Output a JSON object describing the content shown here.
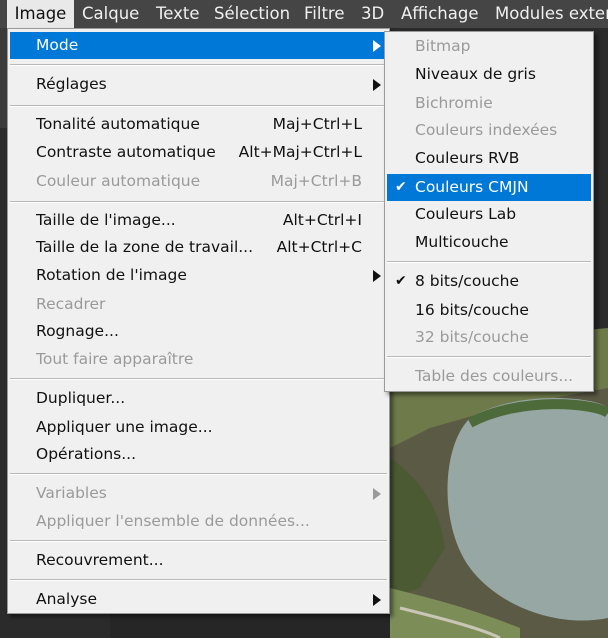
{
  "menubar": {
    "items": [
      "Image",
      "Calque",
      "Texte",
      "Sélection",
      "Filtre",
      "3D",
      "Affichage",
      "Modules exter"
    ]
  },
  "image_menu": {
    "mode": "Mode",
    "reglages": "Réglages",
    "tonalite": {
      "label": "Tonalité automatique",
      "shortcut": "Maj+Ctrl+L"
    },
    "contraste": {
      "label": "Contraste automatique",
      "shortcut": "Alt+Maj+Ctrl+L"
    },
    "couleur_auto": {
      "label": "Couleur automatique",
      "shortcut": "Maj+Ctrl+B"
    },
    "taille_image": {
      "label": "Taille de l'image...",
      "shortcut": "Alt+Ctrl+I"
    },
    "taille_zone": {
      "label": "Taille de la zone de travail...",
      "shortcut": "Alt+Ctrl+C"
    },
    "rotation": "Rotation de l'image",
    "recadrer": "Recadrer",
    "rognage": "Rognage...",
    "tout_faire": "Tout faire apparaître",
    "dupliquer": "Dupliquer...",
    "appliquer_image": "Appliquer une image...",
    "operations": "Opérations...",
    "variables": "Variables",
    "appliquer_ensemble": "Appliquer l'ensemble de données...",
    "recouvrement": "Recouvrement...",
    "analyse": "Analyse"
  },
  "mode_submenu": {
    "bitmap": "Bitmap",
    "niveaux_gris": "Niveaux de gris",
    "bichromie": "Bichromie",
    "couleurs_indexees": "Couleurs indexées",
    "couleurs_rvb": "Couleurs RVB",
    "couleurs_cmjn": "Couleurs CMJN",
    "couleurs_lab": "Couleurs Lab",
    "multicouche": "Multicouche",
    "bits8": "8 bits/couche",
    "bits16": "16 bits/couche",
    "bits32": "32 bits/couche",
    "table_couleurs": "Table des couleurs...",
    "checkmark": "✔"
  },
  "colors": {
    "highlight": "#0078d7",
    "menu_bg": "#f0f0f0",
    "disabled_text": "#9a9a9a"
  }
}
